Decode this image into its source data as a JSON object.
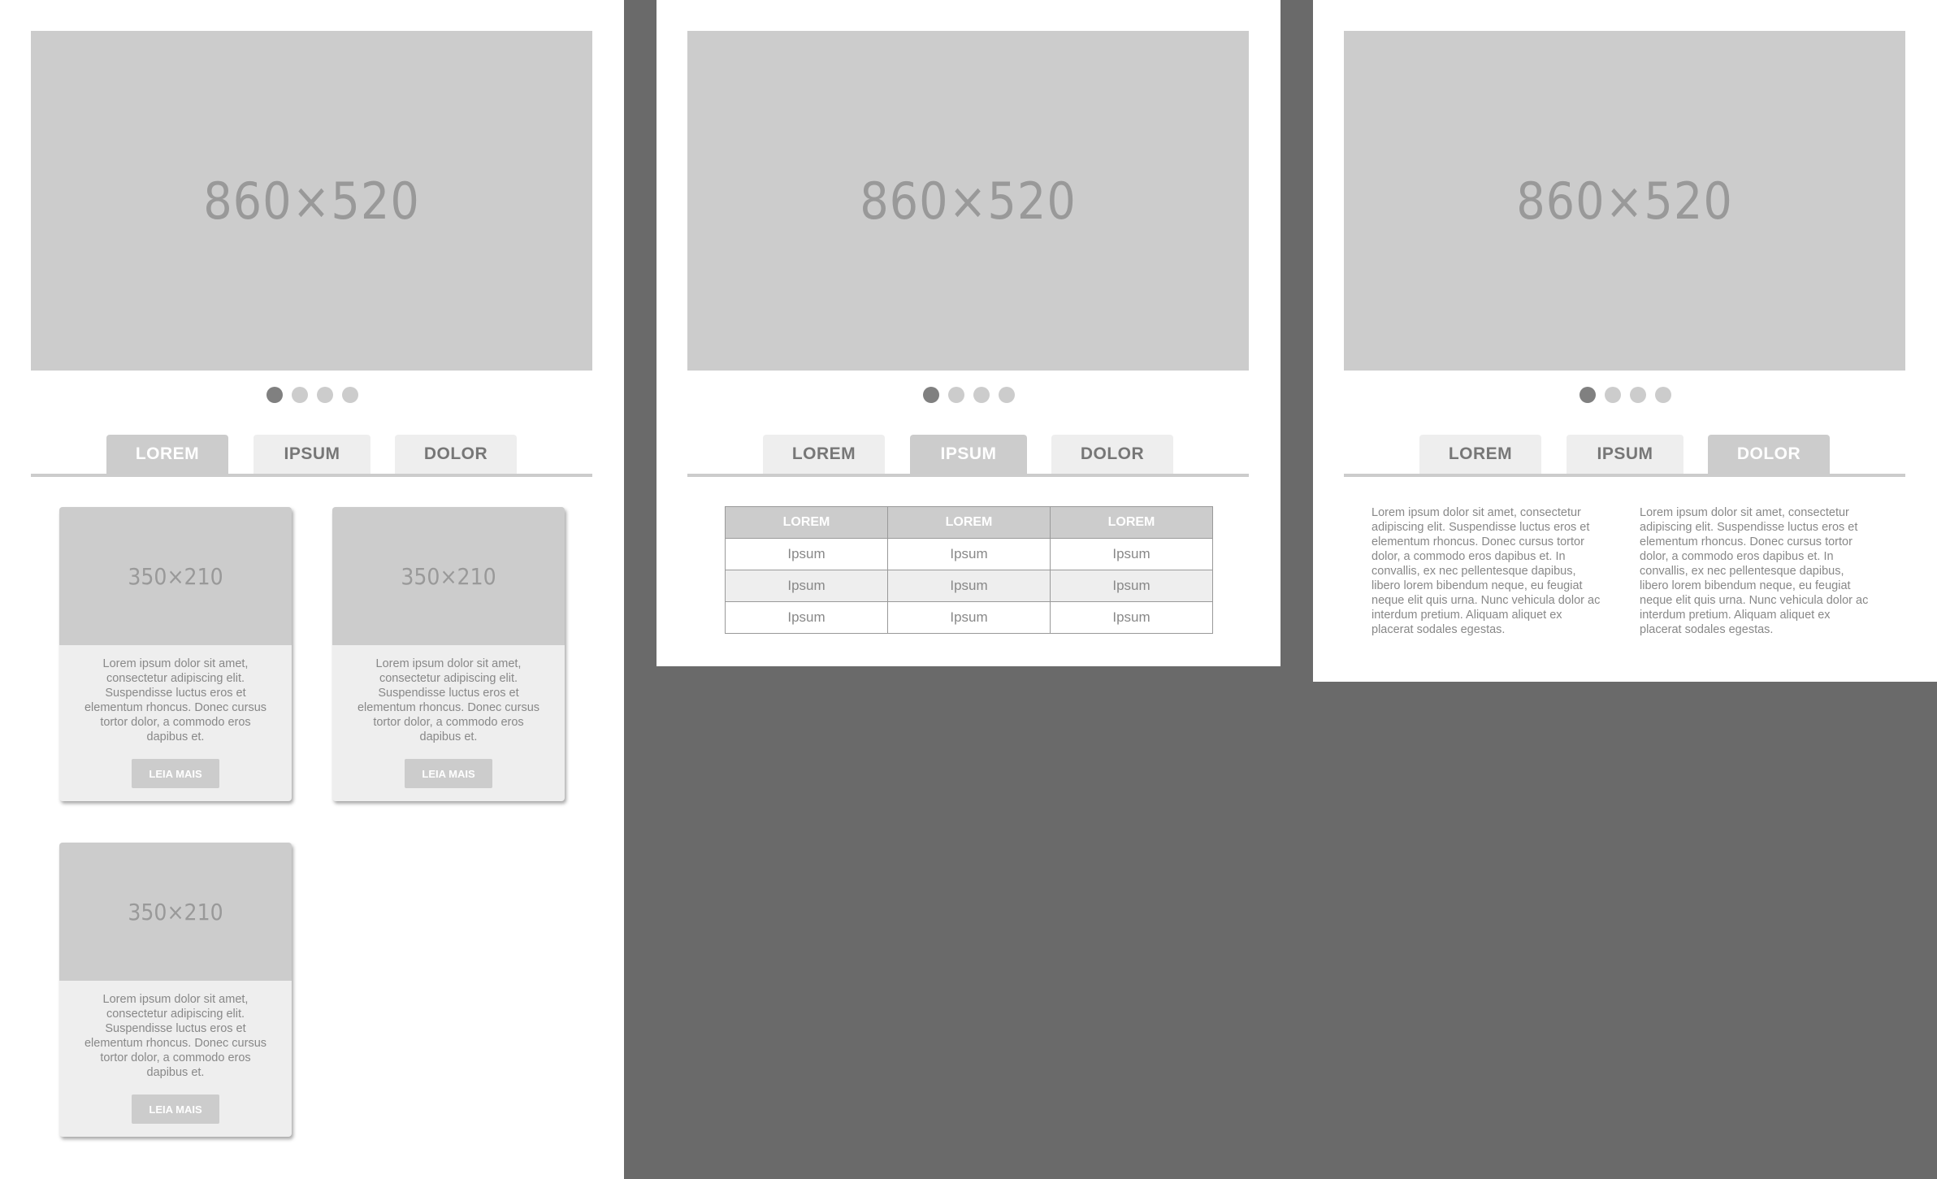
{
  "hero_label": "860×520",
  "tabs": [
    "LOREM",
    "IPSUM",
    "DOLOR"
  ],
  "active_tab": {
    "panel1": 0,
    "panel2": 1,
    "panel3": 2
  },
  "dots_active_index": 0,
  "cards": [
    {
      "thumb_label": "350×210",
      "text": "Lorem ipsum dolor sit amet, consectetur adipiscing elit. Suspendisse luctus eros et elementum rhoncus. Donec cursus tortor dolor, a commodo eros dapibus et.",
      "button": "LEIA MAIS"
    },
    {
      "thumb_label": "350×210",
      "text": "Lorem ipsum dolor sit amet, consectetur adipiscing elit. Suspendisse luctus eros et elementum rhoncus. Donec cursus tortor dolor, a commodo eros dapibus et.",
      "button": "LEIA MAIS"
    },
    {
      "thumb_label": "350×210",
      "text": "Lorem ipsum dolor sit amet, consectetur adipiscing elit. Suspendisse luctus eros et elementum rhoncus. Donec cursus tortor dolor, a commodo eros dapibus et.",
      "button": "LEIA MAIS"
    }
  ],
  "table": {
    "headers": [
      "LOREM",
      "LOREM",
      "LOREM"
    ],
    "rows": [
      [
        "Ipsum",
        "Ipsum",
        "Ipsum"
      ],
      [
        "Ipsum",
        "Ipsum",
        "Ipsum"
      ],
      [
        "Ipsum",
        "Ipsum",
        "Ipsum"
      ]
    ]
  },
  "text_columns": [
    "Lorem ipsum dolor sit amet, consectetur adipiscing elit. Suspendisse luctus eros et elementum rhoncus. Donec cursus tortor dolor, a commodo eros dapibus et. In convallis, ex nec pellentesque dapibus, libero lorem bibendum neque, eu feugiat neque elit quis urna. Nunc vehicula dolor ac interdum pretium. Aliquam aliquet ex placerat sodales egestas.",
    "Lorem ipsum dolor sit amet, consectetur adipiscing elit. Suspendisse luctus eros et elementum rhoncus. Donec cursus tortor dolor, a commodo eros dapibus et. In convallis, ex nec pellentesque dapibus, libero lorem bibendum neque, eu feugiat neque elit quis urna. Nunc vehicula dolor ac interdum pretium. Aliquam aliquet ex placerat sodales egestas."
  ],
  "colors": {
    "background": "#6a6a6a",
    "panel": "#ffffff",
    "placeholder": "#cccccc",
    "placeholder_text": "#999999",
    "tab_inactive": "#eeeeee",
    "dot_active": "#808080"
  }
}
